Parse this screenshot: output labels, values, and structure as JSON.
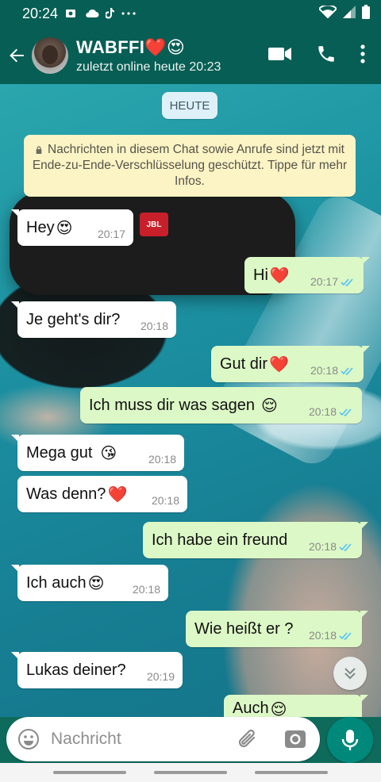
{
  "status_bar": {
    "time": "20:24",
    "left_icons": [
      "video-notification-icon",
      "cloud-icon",
      "tiktok-icon",
      "more-dots-icon"
    ],
    "right_icons": [
      "wifi-icon",
      "signal-icon",
      "battery-icon"
    ]
  },
  "header": {
    "contact_name": "WABFFI",
    "name_emojis": "❤️😍",
    "status": "zuletzt online heute 20:23",
    "icons": [
      "back-arrow-icon",
      "video-call-icon",
      "phone-call-icon",
      "overflow-menu-icon"
    ]
  },
  "chat": {
    "date_chip": "HEUTE",
    "encryption_notice": "Nachrichten in diesem Chat sowie Anrufe sind jetzt mit Ende-zu-Ende-Verschlüsselung geschützt. Tippe für mehr Infos.",
    "messages": [
      {
        "dir": "in",
        "text": "Hey",
        "emoji": "😍",
        "time": "20:17"
      },
      {
        "dir": "out",
        "text": "Hi",
        "emoji": "❤️",
        "time": "20:17",
        "status": "read"
      },
      {
        "dir": "in",
        "text": "Je geht's dir?",
        "emoji": "",
        "time": "20:18"
      },
      {
        "dir": "out",
        "text": "Gut dir",
        "emoji": "❤️",
        "time": "20:18",
        "status": "read"
      },
      {
        "dir": "out",
        "text": "Ich muss dir was sagen",
        "emoji": "😌",
        "time": "20:18",
        "status": "read"
      },
      {
        "dir": "in",
        "text": "Mega gut",
        "emoji": "😘",
        "time": "20:18"
      },
      {
        "dir": "in",
        "text": "Was denn?",
        "emoji": "❤️",
        "time": "20:18"
      },
      {
        "dir": "out",
        "text": "Ich habe ein freund",
        "emoji": "",
        "time": "20:18",
        "status": "read"
      },
      {
        "dir": "in",
        "text": "Ich auch",
        "emoji": "😍",
        "time": "20:18"
      },
      {
        "dir": "out",
        "text": "Wie heißt er ?",
        "emoji": "",
        "time": "20:18",
        "status": "read"
      },
      {
        "dir": "in",
        "text": "Lukas deiner?",
        "emoji": "",
        "time": "20:19"
      },
      {
        "dir": "out",
        "text": "Auch",
        "emoji": "😌",
        "time": "",
        "status": "partial"
      }
    ]
  },
  "composer": {
    "placeholder": "Nachricht",
    "icons": [
      "emoji-icon",
      "attach-icon",
      "camera-icon",
      "mic-icon"
    ]
  },
  "colors": {
    "header": "#075e54",
    "outgoing_bubble": "#dcf8c6",
    "incoming_bubble": "#ffffff",
    "read_ticks": "#4fc3f7",
    "mic_button": "#00897b"
  }
}
